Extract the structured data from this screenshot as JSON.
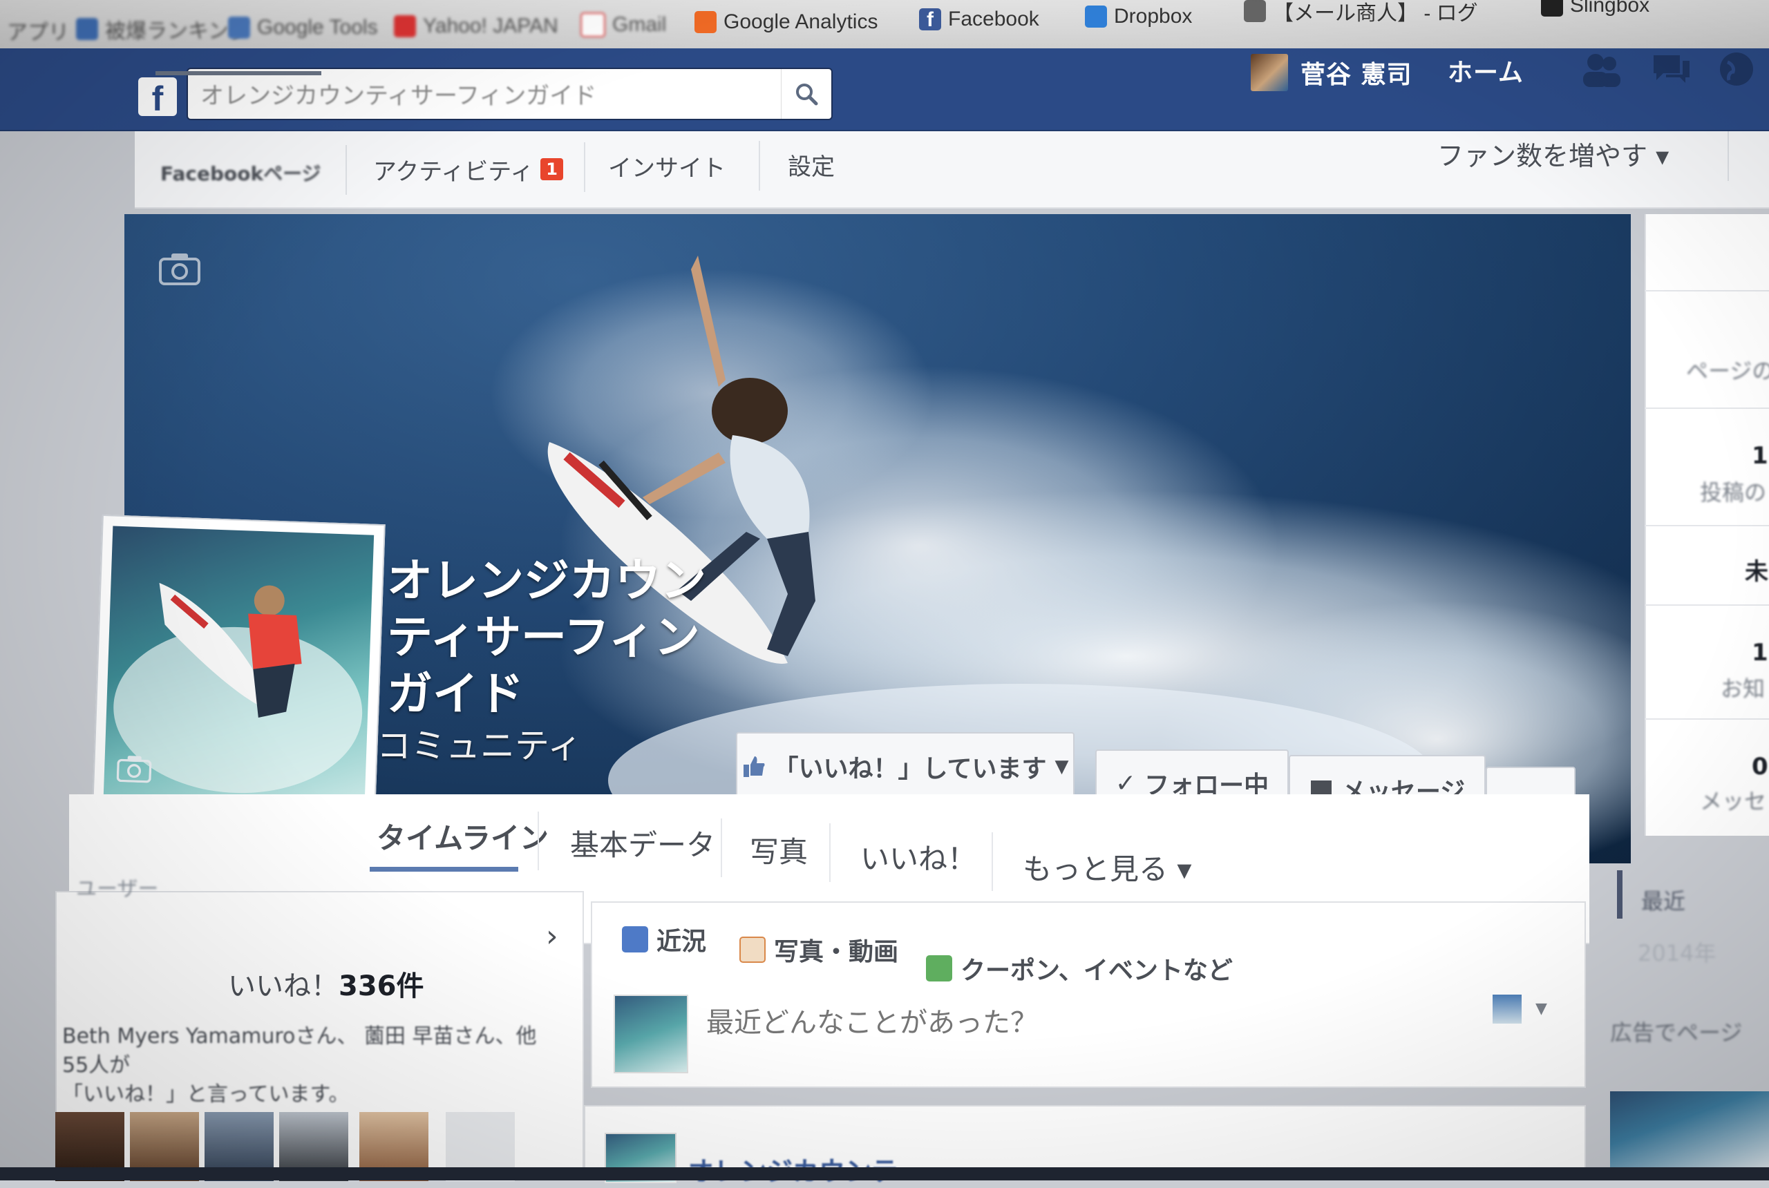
{
  "bookmarks": [
    {
      "label": "アプリ",
      "blur": true
    },
    {
      "label": "被爆ランキング",
      "blur": true
    },
    {
      "label": "Google Tools",
      "blur": true
    },
    {
      "label": "Yahoo! JAPAN",
      "blur": true
    },
    {
      "label": "Gmail",
      "blur": true
    },
    {
      "label": "Google Analytics",
      "blur": false
    },
    {
      "label": "Facebook",
      "blur": false
    },
    {
      "label": "Dropbox",
      "blur": false
    },
    {
      "label": "【メール商人】 - ログ",
      "blur": false
    },
    {
      "label": "Slingbox",
      "blur": false
    }
  ],
  "header": {
    "logo": "f",
    "search_value": "オレンジカウンティサーフィンガイド",
    "user_name": "菅谷 憲司",
    "home_label": "ホーム"
  },
  "admin_tabs": [
    {
      "label": "Facebookページ",
      "active": true
    },
    {
      "label": "アクティビティ",
      "badge": "1"
    },
    {
      "label": "インサイト"
    },
    {
      "label": "設定"
    }
  ],
  "grow_audience_label": "ファン数を増やす ▾",
  "page": {
    "name": "オレンジカウンティサーフィンガイド",
    "category": "コミュニティ",
    "liked_button": "「いいね！」しています",
    "follow_button": "フォロー中",
    "message_button": "メッセージ",
    "more_button": "•••"
  },
  "page_tabs": [
    {
      "label": "タイムライン",
      "active": true
    },
    {
      "label": "基本データ"
    },
    {
      "label": "写真"
    },
    {
      "label": "いいね！"
    },
    {
      "label": "もっと見る ▾"
    }
  ],
  "left": {
    "section_title": "ユーザー",
    "likes_prefix": "いいね！",
    "likes_count": "336件",
    "friends_line1": "Beth Myers Yamamuroさん、 薗田 早苗さん、他55人が",
    "friends_line2": "「いいね！」と言っています。"
  },
  "composer": {
    "tabs": [
      {
        "label": "近況"
      },
      {
        "label": "写真・動画"
      },
      {
        "label": "クーポン、イベントなど"
      }
    ],
    "placeholder": "最近どんなことがあった？"
  },
  "post": {
    "author": "オレンジカウンテ"
  },
  "right": {
    "items": [
      "ページの",
      "1",
      "投稿の",
      "未",
      "1",
      "お知",
      "0",
      "メッセ"
    ],
    "recent_label": "最近",
    "year_label": "2014年",
    "ad_label": "広告でページ"
  },
  "colors": {
    "fb_blue": "#2b4a86",
    "badge_red": "#e8452c",
    "link_blue": "#365899"
  }
}
